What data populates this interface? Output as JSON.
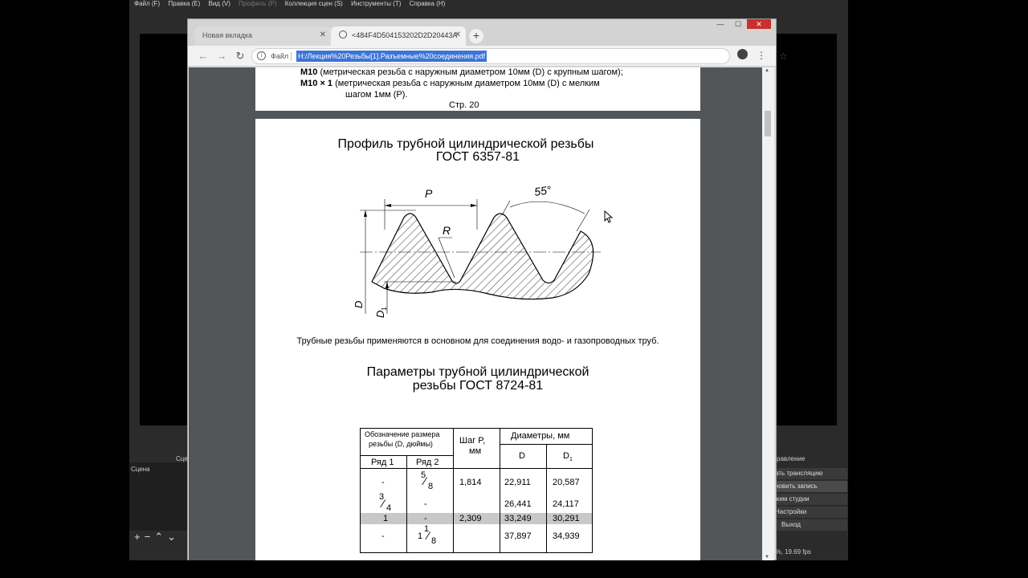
{
  "obs": {
    "menu": [
      "Файл (F)",
      "Правка (E)",
      "Вид (V)",
      "Профиль (P)",
      "Коллекция сцен (S)",
      "Инструменты (T)",
      "Справка (H)"
    ],
    "scenes_title": "Сцена",
    "scenes_tab_label": "Сце",
    "controls_title": "равление",
    "controls": [
      "ать трансляцию",
      "новить запись",
      "жим студии",
      "Настройки",
      "Выход"
    ],
    "status": "9%, 19.69 fps"
  },
  "browser": {
    "tabs": [
      {
        "label": "Новая вкладка",
        "active": false
      },
      {
        "label": "<484F4D504153202D2D20443A",
        "active": true
      }
    ],
    "omnibox": {
      "scheme_label": "Файл",
      "url": "H:/Лекция%20Резьбы[1].Разъемные%20соединения.pdf"
    },
    "colors": {
      "selection": "#3b74d9",
      "close": "#c9302c"
    }
  },
  "pdf": {
    "page1": {
      "line1_bold": "M10",
      "line1": "(метрическая резьба с наружным диаметром 10мм (D) с крупным шагом);",
      "line2_bold": "M10 × 1",
      "line2": "(метрическая резьба с наружным диаметром 10мм (D) с мелким",
      "line3": "шагом 1мм (P).",
      "page_label": "Стр. 20"
    },
    "page2": {
      "title_line1": "Профиль трубной цилиндрической резьбы",
      "title_line2": "ГОСТ 6357-81",
      "diagram_labels": {
        "pitch": "P",
        "angle": "55°",
        "radius": "R",
        "d": "D",
        "d1": "D",
        "d1_sub": "1"
      },
      "caption": "Трубные резьбы применяются в основном для соединения водо- и газопроводных труб.",
      "params_title_line1": "Параметры трубной цилиндрической",
      "params_title_line2": "резьбы ГОСТ 8724-81",
      "table": {
        "header_size": "Обозначение размера",
        "header_size2": "резьбы (D, дюймы)",
        "header_row1": "Ряд 1",
        "header_row2": "Ряд 2",
        "header_pitch": "Шаг P,",
        "header_pitch2": "мм",
        "header_diam": "Диаметры, мм",
        "header_d": "D",
        "header_d1": "D",
        "header_d1_sub": "1",
        "rows": [
          {
            "r1": "-",
            "r2_num": "5",
            "r2_den": "8",
            "pitch": "1,814",
            "d": "22,911",
            "d1": "20,587"
          },
          {
            "r1_num": "3",
            "r1_den": "4",
            "r2": "-",
            "pitch": "",
            "d": "26,441",
            "d1": "24,117"
          },
          {
            "r1": "1",
            "r2": "-",
            "pitch": "2,309",
            "d": "33,249",
            "d1": "30,291"
          },
          {
            "r1": "-",
            "r2_whole": "1",
            "r2_num": "1",
            "r2_den": "8",
            "pitch": "",
            "d": "37,897",
            "d1": "34,939"
          }
        ]
      }
    }
  }
}
